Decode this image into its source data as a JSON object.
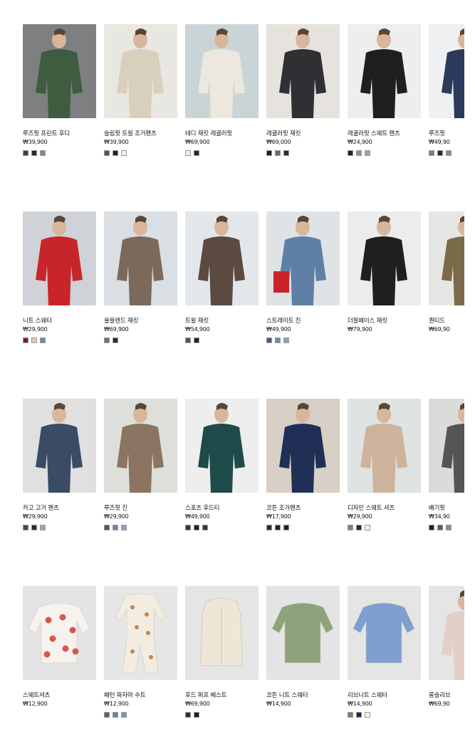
{
  "rows": [
    {
      "items": [
        {
          "name": "루즈핏 프린트 후디",
          "price": "₩39,900",
          "photo_desc": "green-hoodie-man",
          "bg": "#7d7f80",
          "figure": "#3f5c40",
          "swatches": [
            "#3d3d3d",
            "#2a2a2a",
            "#8e8b74"
          ]
        },
        {
          "name": "슬림핏 트윌 조거팬츠",
          "price": "₩39,900",
          "photo_desc": "beige-fleece-man",
          "bg": "#e9e7e2",
          "figure": "#d9cfbd",
          "swatches": [
            "#555555",
            "#222222",
            "#f4f1ea"
          ]
        },
        {
          "name": "테디 재킷 레귤러핏",
          "price": "₩69,900",
          "photo_desc": "teddy-jacket-man",
          "bg": "#c9d4d6",
          "figure": "#ece8df",
          "swatches": [
            "#f2eee6",
            "#1e2433"
          ]
        },
        {
          "name": "레귤러핏 재킷",
          "price": "₩69,000",
          "photo_desc": "black-jacket-man",
          "bg": "#e6e3de",
          "figure": "#2f3033",
          "swatches": [
            "#1f1f1f",
            "#6b6b5e",
            "#2b2b2b"
          ]
        },
        {
          "name": "레귤러핏 스웨트 팬츠",
          "price": "₩24,900",
          "photo_desc": "black-outfit-man",
          "bg": "#eeeeee",
          "figure": "#1f1f1f",
          "swatches": [
            "#1f1f1f",
            "#8f8f8f",
            "#a7a38f"
          ]
        },
        {
          "name": "루즈핏",
          "price": "₩49,90",
          "photo_desc": "partial-card",
          "bg": "#eef0f2",
          "figure": "#2b3a5a",
          "swatches": [
            "#6e7f99",
            "#2a2a2a",
            "#8a8a8a"
          ]
        }
      ]
    },
    {
      "items": [
        {
          "name": "니트 스웨터",
          "price": "₩29,900",
          "photo_desc": "red-knit-woman",
          "bg": "#cfd2d6",
          "figure": "#c8252a",
          "swatches": [
            "#7a1f22",
            "#e2c7c3",
            "#6f89a8"
          ]
        },
        {
          "name": "울블렌드 재킷",
          "price": "₩69,900",
          "photo_desc": "brown-coat-woman",
          "bg": "#d9dfe3",
          "figure": "#7b6a5c",
          "swatches": [
            "#7a7162",
            "#2a2a2a"
          ]
        },
        {
          "name": "트윌 재킷",
          "price": "₩54,900",
          "photo_desc": "brown-blazer-woman",
          "bg": "#e4e7ea",
          "figure": "#5b4a3f",
          "swatches": [
            "#5e5247",
            "#222222"
          ]
        },
        {
          "name": "스트레이트 진",
          "price": "₩49,900",
          "photo_desc": "jeans-woman-red-chair",
          "bg": "#dfe3e6",
          "figure": "#5f7fa6",
          "swatches": [
            "#4a5a78",
            "#6f89b0",
            "#8aa2c2"
          ]
        },
        {
          "name": "더블페이스 재킷",
          "price": "₩79,900",
          "photo_desc": "black-leather-woman",
          "bg": "#eaeced",
          "figure": "#1f1f1f",
          "swatches": []
        },
        {
          "name": "퀀티드",
          "price": "₩69,90",
          "photo_desc": "partial-card",
          "bg": "#e6e6e4",
          "figure": "#7b6a4a",
          "swatches": []
        }
      ]
    },
    {
      "items": [
        {
          "name": "카고 고거 팬츠",
          "price": "₩29,900",
          "photo_desc": "boy-navy-hoodie",
          "bg": "#dfe0df",
          "figure": "#3a4b66",
          "swatches": [
            "#3a4b66",
            "#2a2a2a",
            "#b7a189"
          ]
        },
        {
          "name": "루즈핏 진",
          "price": "₩29,900",
          "photo_desc": "boy-brown-sweat",
          "bg": "#dde0da",
          "figure": "#8c7462",
          "swatches": [
            "#4e5566",
            "#6f87a6",
            "#8aa2c2"
          ]
        },
        {
          "name": "스포츠 후드티",
          "price": "₩49,900",
          "photo_desc": "boy-teal-hoodie",
          "bg": "#eeeeee",
          "figure": "#1e4a4a",
          "swatches": [
            "#1f3f3f",
            "#222222",
            "#4a2b2b"
          ]
        },
        {
          "name": "코튼 조거팬츠",
          "price": "₩17,900",
          "photo_desc": "boy-navy-sweat",
          "bg": "#d8cfc6",
          "figure": "#1f2f55",
          "swatches": [
            "#1f2a44",
            "#222222",
            "#1f1f1f"
          ]
        },
        {
          "name": "디자인 스웨트 셔츠",
          "price": "₩29,900",
          "photo_desc": "girl-beige-sweat",
          "bg": "#dfe3e1",
          "figure": "#cdb39c",
          "swatches": [
            "#8c7a63",
            "#1f2a44",
            "#f3efe8"
          ]
        },
        {
          "name": "배기핏",
          "price": "₩34,90",
          "photo_desc": "partial-card",
          "bg": "#d9dcd8",
          "figure": "#555555",
          "swatches": [
            "#1f1f1f",
            "#4e5e7a",
            "#8a8a8a"
          ]
        }
      ]
    },
    {
      "items": [
        {
          "name": "스웨트셔츠",
          "price": "₩12,900",
          "photo_desc": "baby-strawberry-sweat",
          "bg": "#e4e4e4",
          "figure": "#f6f3ee",
          "swatches": []
        },
        {
          "name": "패턴 파자마 수트",
          "price": "₩12,900",
          "photo_desc": "baby-pajama-suit",
          "bg": "#e6e6e6",
          "figure": "#f3ede1",
          "swatches": [
            "#5f5f5f",
            "#6f7f9f",
            "#7f93b5"
          ]
        },
        {
          "name": "후드 퍼프 베스트",
          "price": "₩69,900",
          "photo_desc": "baby-puffer-vest",
          "bg": "#e5e5e5",
          "figure": "#eee6d6",
          "swatches": [
            "#2b2f38",
            "#1f1f1f"
          ]
        },
        {
          "name": "코튼 니트 스웨터",
          "price": "₩14,900",
          "photo_desc": "baby-green-knit",
          "bg": "#e4e4e4",
          "figure": "#8ea37c",
          "swatches": []
        },
        {
          "name": "리브니트 스웨터",
          "price": "₩14,900",
          "photo_desc": "baby-blue-knit",
          "bg": "#e5e5e5",
          "figure": "#7e9fd0",
          "swatches": [
            "#8c7a63",
            "#1f2a44",
            "#f3efe8"
          ]
        },
        {
          "name": "롱슬리브",
          "price": "₩69,90",
          "photo_desc": "partial-card",
          "bg": "#e5e5e5",
          "figure": "#e3cfc8",
          "swatches": []
        }
      ]
    }
  ]
}
